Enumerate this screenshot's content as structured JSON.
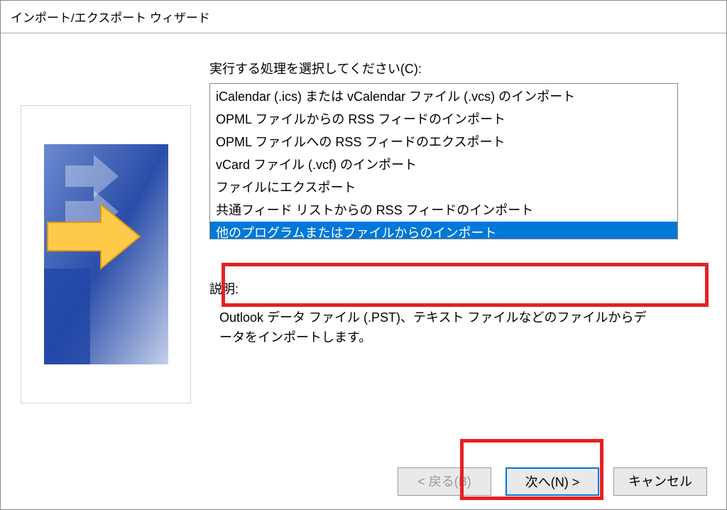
{
  "window": {
    "title": "インポート/エクスポート ウィザード"
  },
  "main": {
    "list_label": "実行する処理を選択してください(C):",
    "items": [
      "iCalendar (.ics) または vCalendar ファイル (.vcs) のインポート",
      "OPML ファイルからの RSS フィードのインポート",
      "OPML ファイルへの RSS フィードのエクスポート",
      "vCard ファイル (.vcf) のインポート",
      "ファイルにエクスポート",
      "共通フィード リストからの RSS フィードのインポート",
      "他のプログラムまたはファイルからのインポート"
    ],
    "desc_label": "説明:",
    "desc_text": "Outlook データ ファイル (.PST)、テキスト ファイルなどのファイルからデータをインポートします。"
  },
  "buttons": {
    "back": "< 戻る(B)",
    "next": "次へ(N) >",
    "cancel": "キャンセル"
  }
}
